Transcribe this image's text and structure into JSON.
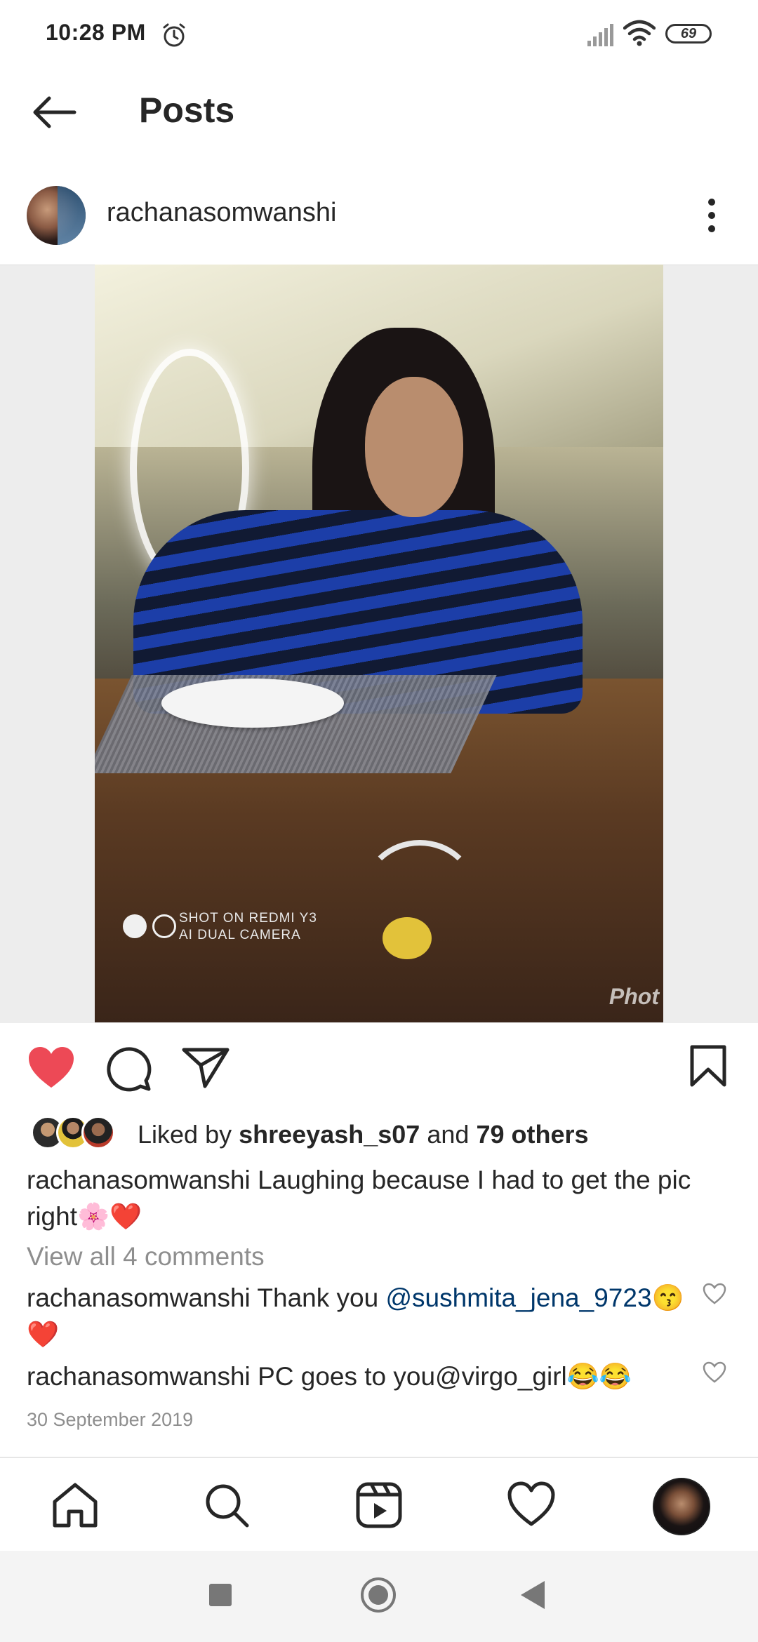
{
  "status_bar": {
    "time": "10:28 PM",
    "battery": "69",
    "icons": [
      "alarm-icon",
      "signal-icon",
      "wifi-icon",
      "battery-icon"
    ]
  },
  "header": {
    "title": "Posts",
    "back_icon": "arrow-left-icon"
  },
  "post": {
    "username": "rachanasomwanshi",
    "more_icon": "more-vertical-icon",
    "photo": {
      "watermark_line1": "SHOT ON REDMI Y3",
      "watermark_line2": "AI DUAL CAMERA",
      "corner_mark": "Phot"
    },
    "actions": {
      "like_icon": "heart-filled-icon",
      "comment_icon": "comment-icon",
      "share_icon": "send-icon",
      "save_icon": "bookmark-icon",
      "liked_color": "#ed4956"
    },
    "likes": {
      "prefix": "Liked by",
      "liker": "shreeyash_s07",
      "conjunction": "and",
      "others": "79 others"
    },
    "caption": {
      "username": "rachanasomwanshi",
      "text": "Laughing because I had to get the pic right🌸❤️"
    },
    "view_all_comments": "View all 4 comments",
    "comments": [
      {
        "username": "rachanasomwanshi",
        "text_before": "Thank you ",
        "mention": "@sushmita_jena_9723",
        "text_after": "😙❤️"
      },
      {
        "username": "rachanasomwanshi",
        "text_before": "PC goes to you@virgo_girl😂😂",
        "mention": "",
        "text_after": ""
      }
    ],
    "date": "30 September 2019"
  },
  "bottom_nav": {
    "items": [
      "home-icon",
      "search-icon",
      "reels-icon",
      "activity-heart-icon",
      "profile-avatar"
    ]
  },
  "system_nav": {
    "items": [
      "recents-square-icon",
      "home-circle-icon",
      "back-triangle-icon"
    ]
  }
}
